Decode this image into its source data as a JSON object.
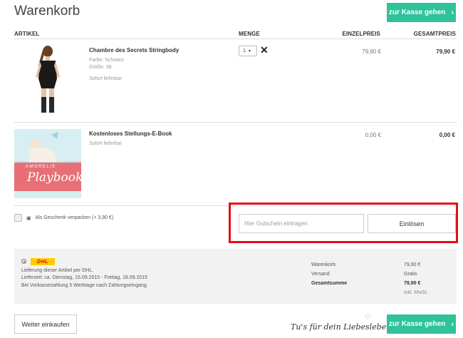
{
  "page": {
    "title": "Warenkorb"
  },
  "checkout_button": {
    "label": "zur Kasse gehen",
    "icon": "chevron-right-icon"
  },
  "table": {
    "headers": {
      "article": "ARTIKEL",
      "quantity": "MENGE",
      "unit_price": "EINZELPREIS",
      "total_price": "GESAMTPREIS"
    }
  },
  "items": [
    {
      "name": "Chambre des Secrets Stringbody",
      "color": "Farbe: Schwarz",
      "size": "Größe: 38",
      "availability": "Sofort lieferbar",
      "quantity": "1",
      "unit_price": "79,90 €",
      "total_price": "79,90 €"
    },
    {
      "name": "Kostenloses Stellungs-E-Book",
      "availability": "Sofort lieferbar",
      "unit_price": "0,00 €",
      "total_price": "0,00 €",
      "image_text_top": "AMORELIE",
      "image_text_main": "Playbook"
    }
  ],
  "gift": {
    "label": "Als Geschenk verpacken (+ 3,90 €)"
  },
  "coupon": {
    "placeholder": "Hier Gutschein eintragen",
    "button_label": "Einlösen"
  },
  "shipping": {
    "carrier": "DHL",
    "line1": "Lieferung dieser Artikel per DHL.",
    "line2": "Lieferzeit: ca. Dienstag, 15.09.2015 - Freitag, 18.09.2015",
    "line3": "Bei Vorkassezahlung 5 Werktage nach Zahlungseingang."
  },
  "summary": {
    "cart_label": "Warenkorb",
    "cart_value": "79,90 €",
    "shipping_label": "Versand",
    "shipping_value": "Gratis",
    "total_label": "Gesamtsumme",
    "total_value": "79,90 €",
    "vat_note": "inkl. MwSt."
  },
  "footer": {
    "continue_label": "Weiter einkaufen",
    "slogan": "Tu's für dein Liebesleben!"
  },
  "colors": {
    "accent": "#2fc29b",
    "highlight": "#e0101a",
    "dhl_yellow": "#ffcc00",
    "dhl_red": "#d40511"
  }
}
